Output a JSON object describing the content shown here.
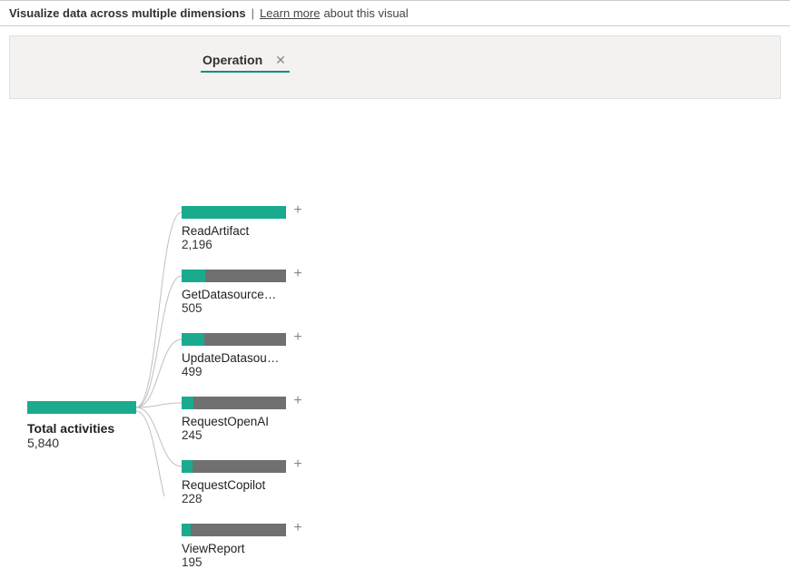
{
  "banner": {
    "bold": "Visualize data across multiple dimensions",
    "sep": "|",
    "link": "Learn more",
    "tail": "about this visual"
  },
  "dimension_chip": {
    "label": "Operation"
  },
  "root": {
    "label": "Total activities",
    "value": "5,840"
  },
  "nodes": [
    {
      "label": "ReadArtifact",
      "value": "2,196",
      "fill_pct": 100
    },
    {
      "label": "GetDatasource…",
      "value": "505",
      "fill_pct": 23
    },
    {
      "label": "UpdateDatasou…",
      "value": "499",
      "fill_pct": 22
    },
    {
      "label": "RequestOpenAI",
      "value": "245",
      "fill_pct": 11
    },
    {
      "label": "RequestCopilot",
      "value": "228",
      "fill_pct": 10
    },
    {
      "label": "ViewReport",
      "value": "195",
      "fill_pct": 9
    }
  ],
  "chart_data": {
    "type": "bar",
    "title": "Total activities by Operation",
    "xlabel": "Operation",
    "ylabel": "Activities",
    "categories": [
      "ReadArtifact",
      "GetDatasource…",
      "UpdateDatasou…",
      "RequestOpenAI",
      "RequestCopilot",
      "ViewReport"
    ],
    "values": [
      2196,
      505,
      499,
      245,
      228,
      195
    ],
    "total": 5840,
    "ylim": [
      0,
      2500
    ]
  }
}
